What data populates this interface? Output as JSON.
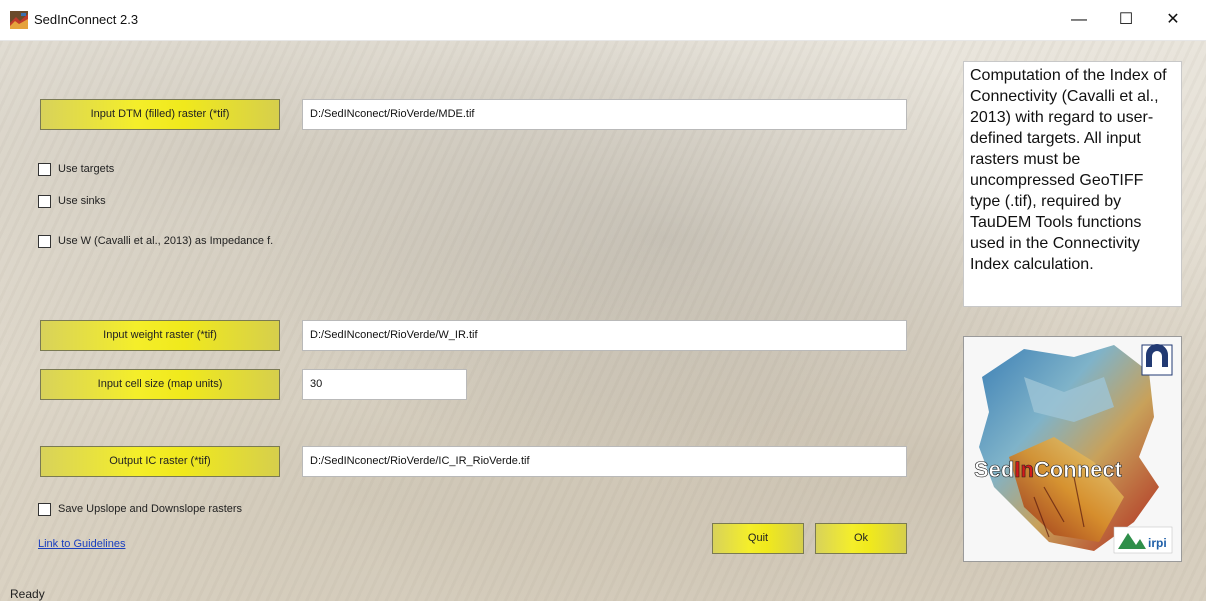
{
  "window": {
    "title": "SedInConnect 2.3",
    "controls": {
      "minimize": "—",
      "maximize": "☐",
      "close": "✕"
    }
  },
  "buttons": {
    "input_dtm": "Input DTM (filled) raster (*tif)",
    "input_weight": "Input weight raster (*tif)",
    "input_cell_size": "Input cell size (map units)",
    "output_ic": "Output IC raster (*tif)",
    "quit": "Quit",
    "ok": "Ok"
  },
  "fields": {
    "dtm_path": "D:/SedINconect/RioVerde/MDE.tif",
    "weight_path": "D:/SedINconect/RioVerde/W_IR.tif",
    "cell_size": "30",
    "output_path": "D:/SedINconect/RioVerde/IC_IR_RioVerde.tif"
  },
  "checkboxes": {
    "use_targets": {
      "label": "Use targets",
      "checked": false
    },
    "use_sinks": {
      "label": "Use sinks",
      "checked": false
    },
    "use_w": {
      "label": "Use W (Cavalli et al., 2013) as Impedance f.",
      "checked": false
    },
    "save_rasters": {
      "label": "Save Upslope and Downslope rasters",
      "checked": false
    }
  },
  "info_text": "Computation of the Index of Connectivity (Cavalli et al., 2013) with regard to user-defined targets. All input rasters must be uncompressed GeoTIFF type (.tif), required by TauDEM Tools functions used in the Connectivity Index calculation.",
  "logo": {
    "brand_pre": "Sed",
    "brand_mid": "In",
    "brand_post": "Connect",
    "irpi": "irpi"
  },
  "link_text": "Link to Guidelines",
  "status_text": "Ready",
  "colors": {
    "button_yellow": "#f0e91c",
    "link": "#1b3fbf",
    "brand_red": "#d41a1a"
  }
}
